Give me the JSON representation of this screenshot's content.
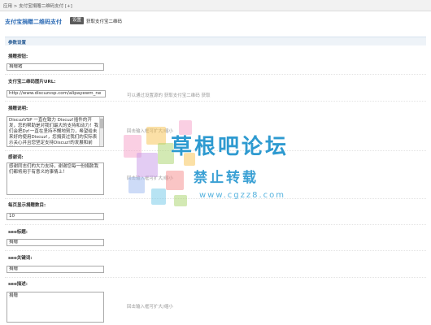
{
  "breadcrumb": "应用 > 支付宝捐赠二维码支付 [+]",
  "header": {
    "plugin_title": "支付宝捐赠二维码支付",
    "tab_settings": "设置",
    "tab_get_qr": "获取支付宝二维码"
  },
  "section_title": "参数设置",
  "fields": {
    "button_label": {
      "label": "捐赠按钮:",
      "value": "捐赠猪"
    },
    "qr_url": {
      "label": "支付宝二维码图片URL:",
      "value": "http://www.discuzvsp.com/alipayewm_ne",
      "hint": "可以通过设置源的 获取支付宝二维码 获取"
    },
    "donate_desc": {
      "label": "捐赠说明:",
      "value": "DiscuzVSP 一直在致力 Discuz!插件的开发，您的帮助是对我们最大的支持和动力！我们会把Dz!一直在坚持不懈地努力，希望给未来好的使用Discuz!，您捐资过我们的实际表示关心并且您坚定支持Discuz!的发展和前进！",
      "hint": "回击输入框可扩大/缩小"
    },
    "thanks_words": {
      "label": "感谢词:",
      "value": "感谢同志们的大力支持，谢谢您每一份捐款我们都将用于有意义的事情上！",
      "hint": "回击输入框可扩大/缩小"
    },
    "per_page": {
      "label": "每页显示捐赠数目:",
      "value": "10"
    },
    "seo_title": {
      "label": "seo标题:",
      "value": "捐赠"
    },
    "seo_keywords": {
      "label": "seo关键词:",
      "value": "捐赠"
    },
    "seo_desc": {
      "label": "seo描述:",
      "value": "捐赠",
      "hint": "回击输入框可扩大/缩小"
    }
  },
  "watermark": {
    "title": "草根吧论坛",
    "subtitle": "禁止转载",
    "url": "www.cgzz8.com",
    "colors": [
      "#f5a0c8",
      "#a7d36a",
      "#f7c14e",
      "#9bb8f0",
      "#c79ae8",
      "#6fc7e8",
      "#f58b8b"
    ]
  }
}
